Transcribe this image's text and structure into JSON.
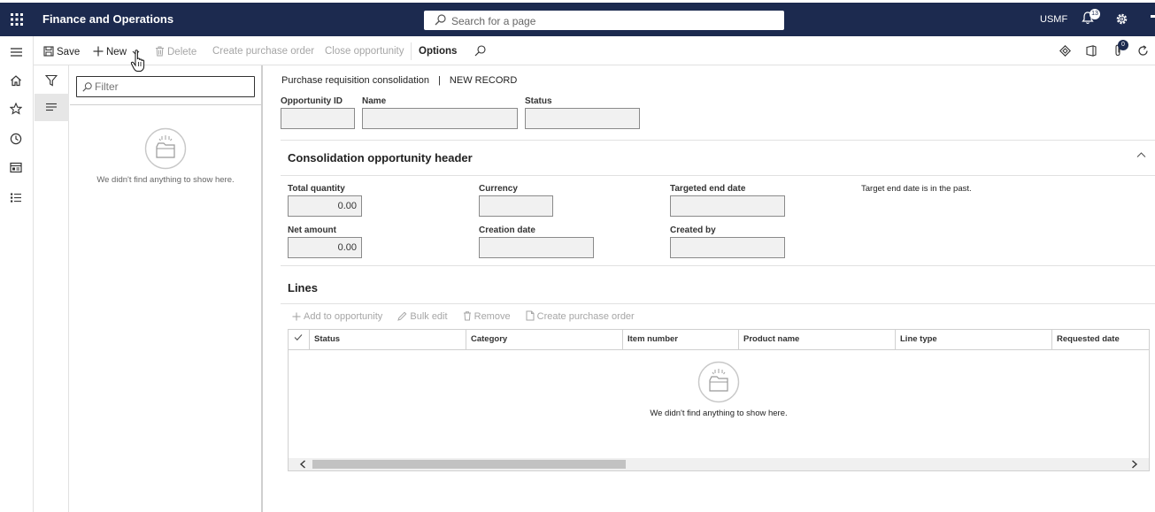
{
  "app": {
    "title": "Finance and Operations",
    "search_placeholder": "Search for a page",
    "company": "USMF",
    "notifications_count": "13"
  },
  "actionbar": {
    "save": "Save",
    "new": "New",
    "delete": "Delete",
    "create_po": "Create purchase order",
    "close_opp": "Close opportunity",
    "options": "Options",
    "attachments_count": "0"
  },
  "list": {
    "filter_placeholder": "Filter",
    "empty": "We didn't find anything to show here."
  },
  "main": {
    "caption_title": "Purchase requisition consolidation",
    "caption_sep": "|",
    "caption_record": "NEW RECORD",
    "fields": {
      "opportunity_id": "Opportunity ID",
      "name": "Name",
      "status": "Status"
    },
    "header": {
      "title": "Consolidation opportunity header",
      "total_quantity_label": "Total quantity",
      "total_quantity": "0.00",
      "currency_label": "Currency",
      "targeted_end_date_label": "Targeted end date",
      "warning": "Target end date is in the past.",
      "net_amount_label": "Net amount",
      "net_amount": "0.00",
      "creation_date_label": "Creation date",
      "created_by_label": "Created by"
    },
    "lines": {
      "title": "Lines",
      "toolbar": {
        "add": "Add to opportunity",
        "bulk": "Bulk edit",
        "remove": "Remove",
        "create_po": "Create purchase order"
      },
      "columns": [
        "Status",
        "Category",
        "Item number",
        "Product name",
        "Line type",
        "Requested date"
      ],
      "empty": "We didn't find anything to show here."
    }
  },
  "colors": {
    "topbar": "#1c2a4f",
    "disabled_text": "#a6a6a6"
  },
  "icons": [
    "waffle-icon",
    "search-icon",
    "bell-icon",
    "gear-icon",
    "hamburger-icon",
    "home-icon",
    "star-icon",
    "clock-icon",
    "workspace-icon",
    "list-icon",
    "filter-icon",
    "save-icon",
    "plus-icon",
    "chevron-down-icon",
    "trash-icon",
    "refresh-icon",
    "office-icon",
    "diamond-icon",
    "paperclip-icon",
    "edit-icon",
    "document-icon",
    "checkmark-icon"
  ]
}
